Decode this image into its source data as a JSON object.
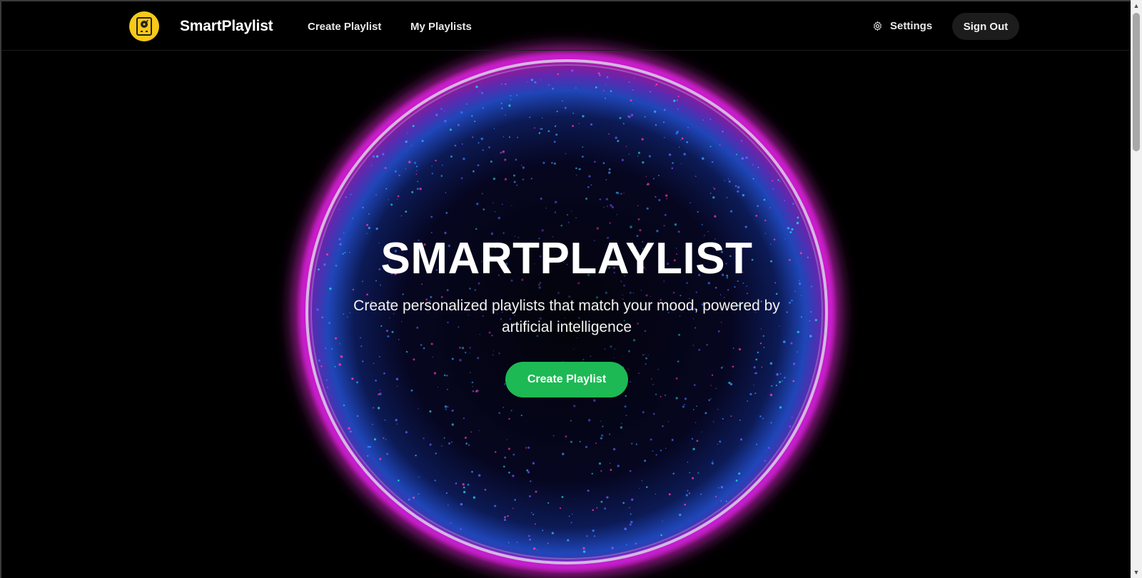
{
  "header": {
    "brand": "SmartPlaylist",
    "nav": {
      "create_playlist": "Create Playlist",
      "my_playlists": "My Playlists"
    },
    "settings_label": "Settings",
    "sign_out_label": "Sign Out"
  },
  "hero": {
    "title": "SMARTPLAYLIST",
    "subtitle": "Create personalized playlists that match your mood, powered by artificial intelligence",
    "cta_label": "Create Playlist"
  },
  "colors": {
    "background": "#000000",
    "accent_green": "#1db954",
    "logo_yellow": "#f6c91a",
    "orb_magenta": "#d21fd2",
    "orb_blue": "#2a6cff"
  },
  "icons": {
    "logo": "record-player-icon",
    "settings": "gear-icon"
  }
}
